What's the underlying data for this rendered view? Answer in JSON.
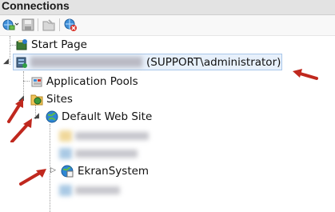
{
  "header": {
    "title": "Connections"
  },
  "tree": {
    "start_page": "Start Page",
    "server_suffix": "(SUPPORT\\administrator)",
    "app_pools": "Application Pools",
    "sites": "Sites",
    "default_web_site": "Default Web Site",
    "ekran": "EkranSystem",
    "expander_open": "◢",
    "expander_closed": "▷"
  },
  "colors": {
    "annotation_arrow": "#c0281e",
    "selection_bg": "#e7f0fb",
    "selection_border": "#a9c7ea"
  },
  "icons": [
    "connect-icon",
    "save-icon",
    "folder-icon",
    "disconnect-icon",
    "start-page-icon",
    "server-icon",
    "app-pools-icon",
    "sites-folder-icon",
    "globe-icon",
    "ekran-site-icon"
  ]
}
